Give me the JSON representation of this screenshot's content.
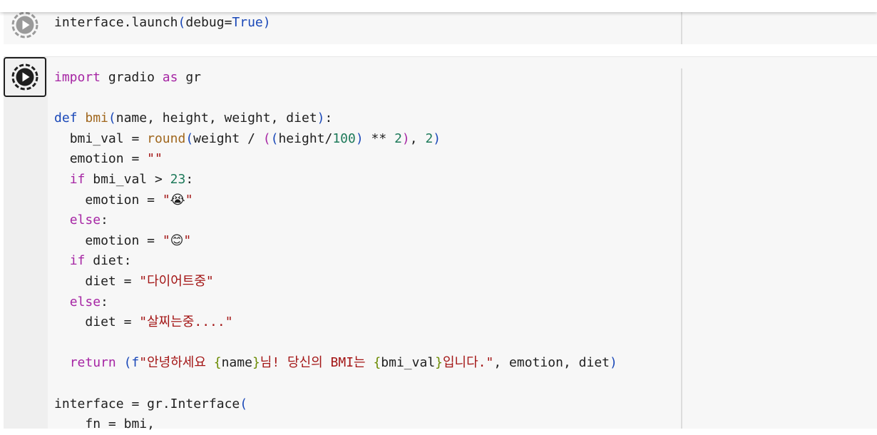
{
  "cells": [
    {
      "lines": [
        "interface.launch(debug=True)"
      ]
    },
    {
      "lines": [
        "import gradio as gr",
        "",
        "def bmi(name, height, weight, diet):",
        "  bmi_val = round(weight / ((height/100) ** 2), 2)",
        "  emotion = \"\"",
        "  if bmi_val > 23:",
        "    emotion = \"😭\"",
        "  else:",
        "    emotion = \"😊\"",
        "  if diet:",
        "    diet = \"다이어트중\"",
        "  else:",
        "    diet = \"살찌는중....\"",
        "",
        "  return (f\"안녕하세요 {name}님! 당신의 BMI는 {bmi_val}입니다.\", emotion, diet)",
        "",
        "interface = gr.Interface(",
        "    fn = bmi,"
      ]
    }
  ],
  "run_button_label": "Run cell",
  "colors": {
    "keyword": "#a626a4",
    "def": "#1a48b8",
    "function": "#a0671e",
    "number": "#1e7a5a",
    "string": "#a31515",
    "constant": "#1a48b8"
  }
}
